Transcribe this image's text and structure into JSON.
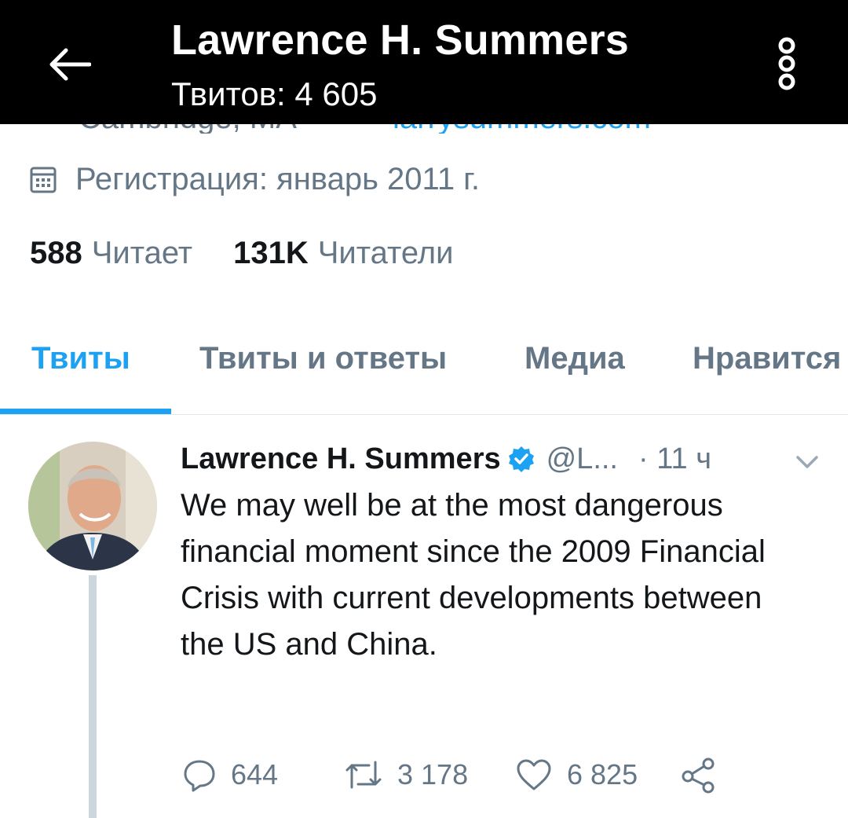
{
  "header": {
    "title": "Lawrence H. Summers",
    "tweet_count": "Твитов: 4 605"
  },
  "profile": {
    "location_clipped": "Cambridge, MA",
    "website_clipped": "larrysummers.com",
    "registration": "Регистрация: январь 2011 г.",
    "following_count": "588",
    "following_label": "Читает",
    "followers_count": "131K",
    "followers_label": "Читатели"
  },
  "tabs": [
    {
      "label": "Твиты",
      "active": true
    },
    {
      "label": "Твиты и ответы",
      "active": false
    },
    {
      "label": "Медиа",
      "active": false
    },
    {
      "label": "Нравится",
      "active": false
    }
  ],
  "tweet": {
    "author": "Lawrence H. Summers",
    "handle": "@L...",
    "time": "· 11 ч",
    "text": "We may well be at the most dangerous financial moment since the 2009 Financial Crisis with current developments between the US and China.",
    "replies": "644",
    "retweets": "3 178",
    "likes": "6 825"
  },
  "colors": {
    "accent": "#1da1f2",
    "muted": "#657786",
    "header_bg": "#000000"
  },
  "icons": [
    "back-arrow-icon",
    "more-options-icon",
    "calendar-icon",
    "verified-badge-icon",
    "chevron-down-icon",
    "reply-icon",
    "retweet-icon",
    "like-icon",
    "share-icon"
  ]
}
